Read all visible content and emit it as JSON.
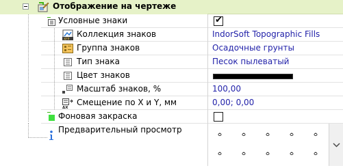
{
  "group": {
    "label": "Отображение на чертеже"
  },
  "rows": {
    "symbols": {
      "label": "Условные знаки",
      "checked": true,
      "check_glyph": "✔"
    },
    "collection": {
      "label": "Коллекция знаков",
      "value": "IndorSoft Topographic Fills"
    },
    "sign_group": {
      "label": "Группа знаков",
      "value": "Осадочные грунты"
    },
    "sign_type": {
      "label": "Тип знака",
      "value": "Песок пылеватый"
    },
    "sign_color": {
      "label": "Цвет знаков",
      "value_color": "#000000"
    },
    "scale": {
      "label": "Масштаб знаков, %",
      "value": "100,00"
    },
    "offset": {
      "label": "Смещение по X и Y, мм",
      "value": "0,00; 0,00"
    },
    "background": {
      "label": "Фоновая закраска",
      "checked": false
    },
    "preview": {
      "label": "Предварительный просмотр"
    }
  },
  "icons": {
    "group": "drawing-settings-icon",
    "symbols": "symbol-grid-icon",
    "collection": "fill-collection-icon",
    "sign_group": "sign-group-icon",
    "sign_type": "sign-type-icon",
    "sign_color": "color-icon",
    "scale": "scale-icon",
    "offset": "offset-xy-icon",
    "background": "background-fill-icon",
    "preview": "info-icon",
    "dropdown": "chevron-down-icon"
  },
  "colors": {
    "group_bg": "#e6f2c8",
    "value_text": "#1f1fa8",
    "accent_green": "#3fb618"
  }
}
